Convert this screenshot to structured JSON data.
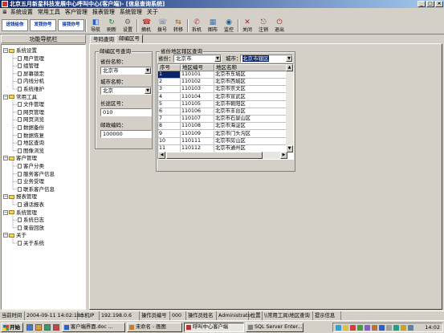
{
  "window": {
    "title": "北京五月新星科技发展中心呼叫中心(客户端)- [信息查询系统]"
  },
  "menu": [
    "系统设置",
    "常用工具",
    "客户管理",
    "报表管理",
    "系统管理",
    "关于"
  ],
  "toolbar": {
    "logos": [
      "送钱给你",
      "发我你号",
      "接我你号"
    ],
    "buttons": [
      {
        "label": "导航",
        "icon": "navigate-icon"
      },
      {
        "label": "刷新",
        "icon": "refresh-icon"
      },
      {
        "label": "设置",
        "icon": "settings-icon"
      },
      {
        "label": "摘机",
        "icon": "offhook-icon"
      },
      {
        "label": "拨号",
        "icon": "dial-icon"
      },
      {
        "label": "转移",
        "icon": "transfer-icon"
      },
      {
        "label": "拆机",
        "icon": "hangup-icon"
      },
      {
        "label": "图布",
        "icon": "layout-icon"
      },
      {
        "label": "监控",
        "icon": "monitor-icon"
      },
      {
        "label": "关闭",
        "icon": "close-icon"
      },
      {
        "label": "注销",
        "icon": "logout-icon"
      },
      {
        "label": "退出",
        "icon": "exit-icon"
      }
    ]
  },
  "nav": {
    "header": "功能导航栏",
    "tree": [
      {
        "label": "系统设置",
        "level": 0,
        "type": "folder"
      },
      {
        "label": "用户管理",
        "level": 1,
        "type": "leaf"
      },
      {
        "label": "组管理",
        "level": 1,
        "type": "leaf"
      },
      {
        "label": "屏幕锁定",
        "level": 1,
        "type": "leaf"
      },
      {
        "label": "内线分机",
        "level": 1,
        "type": "leaf"
      },
      {
        "label": "系统维护",
        "level": 1,
        "type": "leaf"
      },
      {
        "label": "常用工具",
        "level": 0,
        "type": "folder"
      },
      {
        "label": "文件管理",
        "level": 1,
        "type": "leaf"
      },
      {
        "label": "网页管理",
        "level": 1,
        "type": "leaf"
      },
      {
        "label": "网页浏览",
        "level": 1,
        "type": "leaf"
      },
      {
        "label": "数据备份",
        "level": 1,
        "type": "leaf"
      },
      {
        "label": "数据恢复",
        "level": 1,
        "type": "leaf"
      },
      {
        "label": "地区查询",
        "level": 1,
        "type": "leaf"
      },
      {
        "label": "图像浏览",
        "level": 1,
        "type": "leaf"
      },
      {
        "label": "客户管理",
        "level": 0,
        "type": "folder"
      },
      {
        "label": "客户分类",
        "level": 1,
        "type": "leaf"
      },
      {
        "label": "服务客户信息",
        "level": 1,
        "type": "leaf"
      },
      {
        "label": "业务受理",
        "level": 1,
        "type": "leaf"
      },
      {
        "label": "联系客户信息",
        "level": 1,
        "type": "leaf"
      },
      {
        "label": "报表管理",
        "level": 0,
        "type": "folder"
      },
      {
        "label": "通话报表",
        "level": 1,
        "type": "leaf"
      },
      {
        "label": "系统管理",
        "level": 0,
        "type": "folder"
      },
      {
        "label": "系统日志",
        "level": 1,
        "type": "leaf"
      },
      {
        "label": "录音回放",
        "level": 1,
        "type": "leaf"
      },
      {
        "label": "关于",
        "level": 0,
        "type": "folder"
      },
      {
        "label": "关于系统",
        "level": 1,
        "type": "leaf"
      }
    ]
  },
  "tabs": [
    "号码查询",
    "邮编区号"
  ],
  "active_tab": 1,
  "postal_group": {
    "title": "邮编区号查询",
    "province_label": "省份名称：",
    "province_value": "北京市",
    "city_label": "城市名称：",
    "city_value": "北京",
    "area_code_label": "长途区号：",
    "area_code_value": "010",
    "postal_label": "邮政编码：",
    "postal_value": "100000"
  },
  "region_group": {
    "title": "省份地区辖区查询",
    "province_label": "省份：",
    "province_value": "北京市",
    "city_label": "城市：",
    "city_value": "北京市辖区",
    "columns": [
      "序号",
      "地区编号",
      "地区名称"
    ],
    "rows": [
      [
        "1",
        "110101",
        "北京市东城区"
      ],
      [
        "2",
        "110102",
        "北京市西城区"
      ],
      [
        "3",
        "110103",
        "北京市崇文区"
      ],
      [
        "4",
        "110104",
        "北京市宣武区"
      ],
      [
        "5",
        "110105",
        "北京市朝阳区"
      ],
      [
        "6",
        "110106",
        "北京市丰台区"
      ],
      [
        "7",
        "110107",
        "北京市石景山区"
      ],
      [
        "8",
        "110108",
        "北京市海淀区"
      ],
      [
        "9",
        "110109",
        "北京市门头沟区"
      ],
      [
        "10",
        "110111",
        "北京市房山区"
      ],
      [
        "11",
        "110112",
        "北京市通州区"
      ]
    ],
    "selected_row": 0
  },
  "status": {
    "time_label": "当前时间",
    "time_value": "2004-09-11 14:02:18",
    "ip_label": "本机IP",
    "ip_value": "192.198.0.6",
    "op_id_label": "操作员编号",
    "op_id_value": "000",
    "op_name_label": "操作员姓名",
    "op_name_value": "Administrator",
    "location_label": "位置",
    "location_value": "\\\\常用工具\\地区查询",
    "hint_label": "提示信息"
  },
  "taskbar": {
    "start_label": "开始",
    "tasks": [
      {
        "label": "客户端界面.doc ...",
        "color": "#2a5fd0"
      },
      {
        "label": "未命名 - 画图",
        "color": "#c08030"
      },
      {
        "label": "呼叫中心客户端",
        "color": "#c03030"
      },
      {
        "label": "SQL Server Enter...",
        "color": "#808080"
      }
    ],
    "active_task": 2,
    "clock": "14:02"
  }
}
